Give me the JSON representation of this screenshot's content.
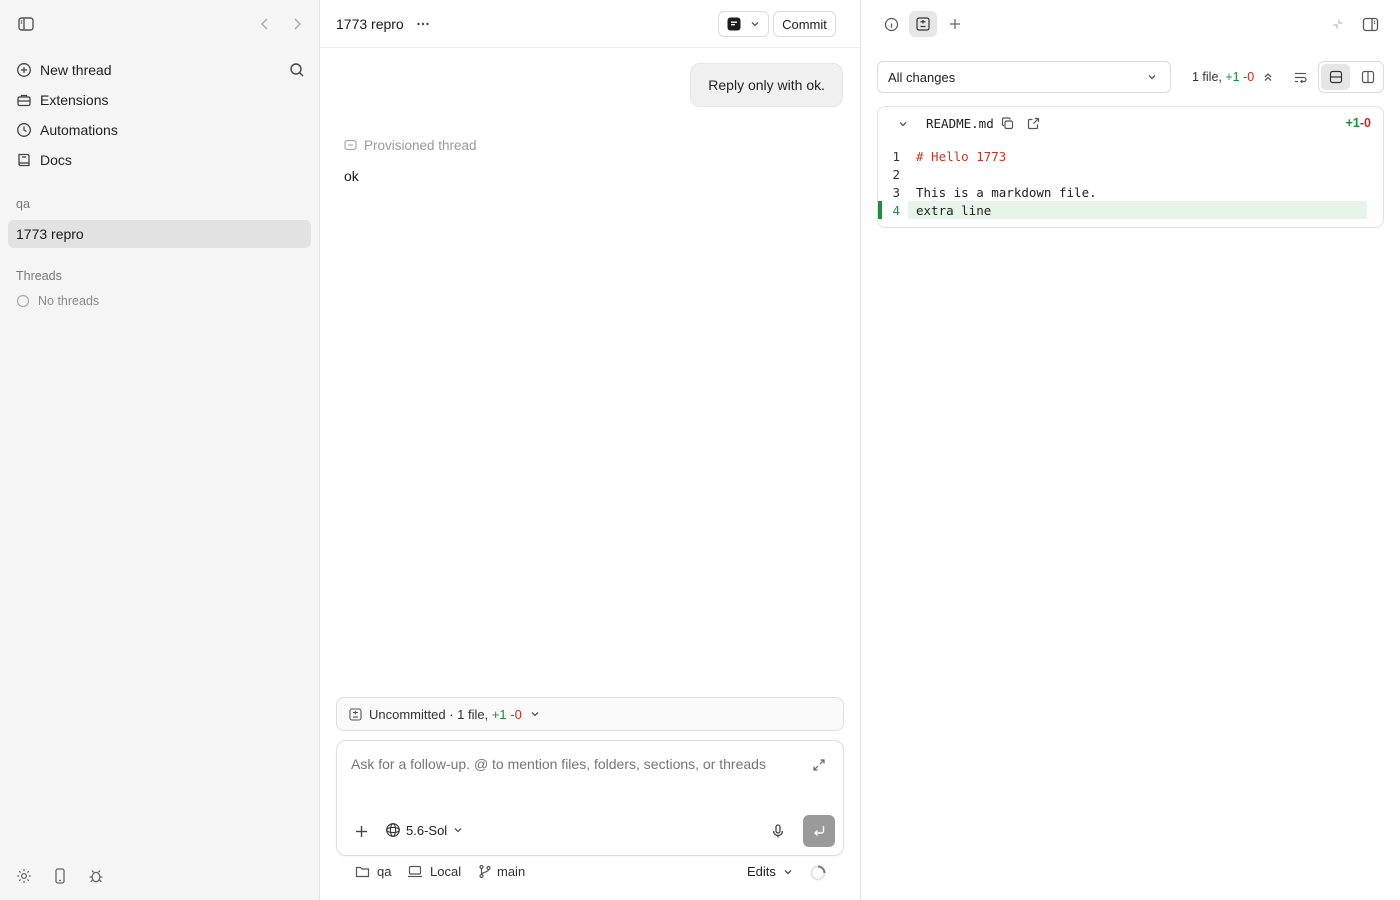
{
  "sidebar": {
    "nav": [
      {
        "label": "New thread",
        "icon": "plus-circle-icon"
      },
      {
        "label": "Extensions",
        "icon": "toolbox-icon"
      },
      {
        "label": "Automations",
        "icon": "clock-icon"
      },
      {
        "label": "Docs",
        "icon": "book-icon"
      }
    ],
    "project_label": "qa",
    "active_thread": "1773 repro",
    "threads_label": "Threads",
    "no_threads": "No threads"
  },
  "main": {
    "title": "1773 repro",
    "commit_label": "Commit",
    "user_message": "Reply only with ok.",
    "provisioned_label": "Provisioned thread",
    "assistant_reply": "ok",
    "uncommitted": {
      "prefix": "Uncommitted · 1 file, ",
      "added": "+1",
      "removed": "-0"
    },
    "composer": {
      "placeholder": "Ask for a follow-up. @ to mention files, folders, sections, or threads",
      "model": "5.6-Sol"
    },
    "footer": {
      "folder": "qa",
      "location": "Local",
      "branch": "main",
      "edits": "Edits"
    }
  },
  "panel": {
    "filter": "All changes",
    "summary": {
      "prefix": "1 file, ",
      "added": "+1",
      "removed": "-0"
    },
    "file": {
      "name": "README.md",
      "added": "+1",
      "removed": "-0",
      "lines": [
        {
          "num": "1",
          "text": "# Hello 1773",
          "heading": true,
          "added": false
        },
        {
          "num": "2",
          "text": "",
          "heading": false,
          "added": false
        },
        {
          "num": "3",
          "text": "This is a markdown file.",
          "heading": false,
          "added": false
        },
        {
          "num": "4",
          "text": "extra line",
          "heading": false,
          "added": true
        }
      ]
    }
  },
  "colors": {
    "added": "#1a8f3c",
    "removed": "#c42b2b",
    "added_bg": "#e6f4ea",
    "heading": "#c0392b"
  }
}
